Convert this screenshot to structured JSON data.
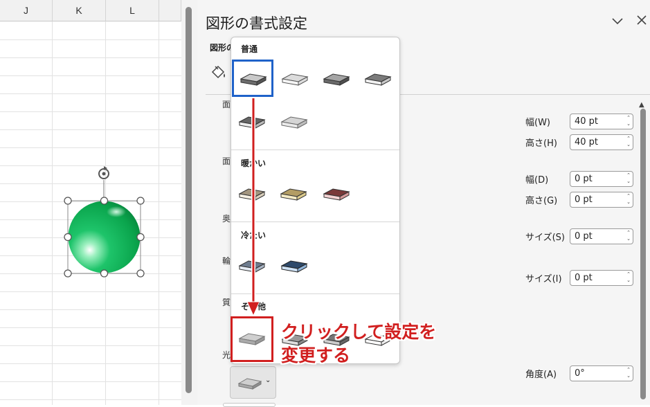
{
  "sheet": {
    "columns": [
      "J",
      "K",
      "L"
    ]
  },
  "pane": {
    "title": "図形の書式設定",
    "tab_partial": "図形の",
    "section_labels": [
      "面",
      "面",
      "奥",
      "輪",
      "質",
      "光"
    ],
    "fields": {
      "width_w": {
        "label": "幅(W)",
        "value": "40 pt"
      },
      "height_h": {
        "label": "高さ(H)",
        "value": "40 pt"
      },
      "width_d": {
        "label": "幅(D)",
        "value": "0 pt"
      },
      "height_g": {
        "label": "高さ(G)",
        "value": "0 pt"
      },
      "size_s": {
        "label": "サイズ(S)",
        "value": "0 pt"
      },
      "size_i": {
        "label": "サイズ(I)",
        "value": "0 pt"
      },
      "angle_a": {
        "label": "角度(A)",
        "value": "0°"
      }
    }
  },
  "gallery": {
    "groups": [
      {
        "label": "普通"
      },
      {
        "label": "暖かい"
      },
      {
        "label": "冷たい"
      },
      {
        "label": "その他"
      }
    ]
  },
  "annotation": {
    "line1": "クリックして設定を",
    "line2": "変更する"
  },
  "colors": {
    "blue_highlight": "#1f62c9",
    "red_annotation": "#d11f1f",
    "sphere": "#16b65a"
  }
}
